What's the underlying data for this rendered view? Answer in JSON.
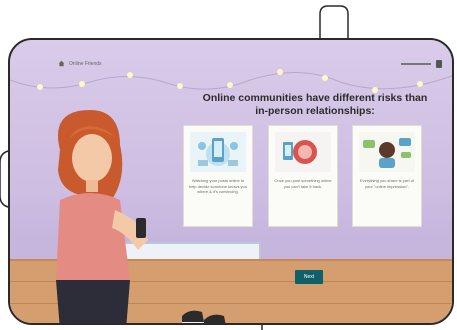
{
  "breadcrumb": {
    "text": "Online Friends"
  },
  "heading": "Online communities have different risks than in-person relationships:",
  "cards": [
    {
      "caption": "Watching your posts online to help decide someone knows you where & it's convincing."
    },
    {
      "caption": "Once you post something online you can't take it back."
    },
    {
      "caption": "Everything you share is part of your \"online impression\"."
    }
  ],
  "next_button": {
    "label": "Next"
  },
  "colors": {
    "wall": "#d4c6e6",
    "floor": "#d59e6e",
    "button": "#10606a",
    "heading": "#2b2b2b"
  },
  "icons": [
    "home-icon",
    "phone-person-icon",
    "shield-icon",
    "profile-chat-icon"
  ]
}
